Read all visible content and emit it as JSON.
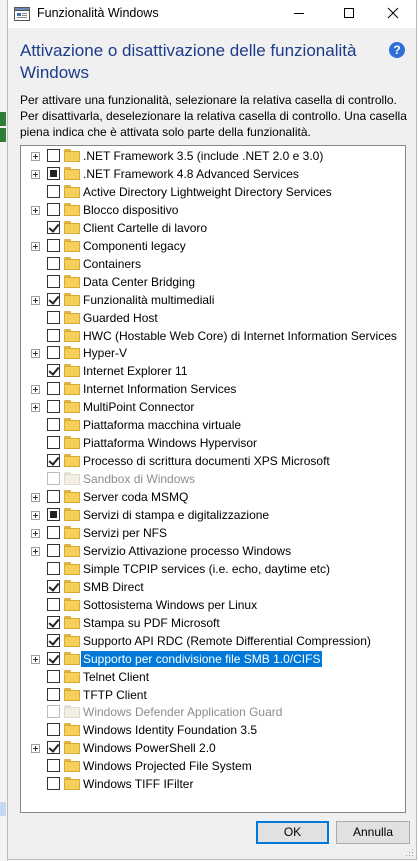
{
  "window": {
    "title": "Funzionalità Windows",
    "heading": "Attivazione o disattivazione delle funzionalità Windows",
    "description": "Per attivare una funzionalità, selezionare la relativa casella di controllo. Per disattivarla, deselezionare la relativa casella di controllo. Una casella piena indica che è attivata solo parte della funzionalità.",
    "help": "?"
  },
  "features": [
    {
      "label": ".NET Framework 3.5 (include .NET 2.0 e 3.0)",
      "expandable": true,
      "state": "unchecked",
      "enabled": true
    },
    {
      "label": ".NET Framework 4.8 Advanced Services",
      "expandable": true,
      "state": "partial",
      "enabled": true
    },
    {
      "label": "Active Directory Lightweight Directory Services",
      "expandable": false,
      "state": "unchecked",
      "enabled": true
    },
    {
      "label": "Blocco dispositivo",
      "expandable": true,
      "state": "unchecked",
      "enabled": true
    },
    {
      "label": "Client Cartelle di lavoro",
      "expandable": false,
      "state": "checked",
      "enabled": true
    },
    {
      "label": "Componenti legacy",
      "expandable": true,
      "state": "unchecked",
      "enabled": true
    },
    {
      "label": "Containers",
      "expandable": false,
      "state": "unchecked",
      "enabled": true
    },
    {
      "label": "Data Center Bridging",
      "expandable": false,
      "state": "unchecked",
      "enabled": true
    },
    {
      "label": "Funzionalità multimediali",
      "expandable": true,
      "state": "checked",
      "enabled": true
    },
    {
      "label": "Guarded Host",
      "expandable": false,
      "state": "unchecked",
      "enabled": true
    },
    {
      "label": "HWC (Hostable Web Core) di Internet Information Services",
      "expandable": false,
      "state": "unchecked",
      "enabled": true
    },
    {
      "label": "Hyper-V",
      "expandable": true,
      "state": "unchecked",
      "enabled": true
    },
    {
      "label": "Internet Explorer 11",
      "expandable": false,
      "state": "checked",
      "enabled": true
    },
    {
      "label": "Internet Information Services",
      "expandable": true,
      "state": "unchecked",
      "enabled": true
    },
    {
      "label": "MultiPoint Connector",
      "expandable": true,
      "state": "unchecked",
      "enabled": true
    },
    {
      "label": "Piattaforma macchina virtuale",
      "expandable": false,
      "state": "unchecked",
      "enabled": true
    },
    {
      "label": "Piattaforma Windows Hypervisor",
      "expandable": false,
      "state": "unchecked",
      "enabled": true
    },
    {
      "label": "Processo di scrittura documenti XPS Microsoft",
      "expandable": false,
      "state": "checked",
      "enabled": true
    },
    {
      "label": "Sandbox di Windows",
      "expandable": false,
      "state": "unchecked",
      "enabled": false
    },
    {
      "label": "Server coda MSMQ",
      "expandable": true,
      "state": "unchecked",
      "enabled": true
    },
    {
      "label": "Servizi di stampa e digitalizzazione",
      "expandable": true,
      "state": "partial",
      "enabled": true
    },
    {
      "label": "Servizi per NFS",
      "expandable": true,
      "state": "unchecked",
      "enabled": true
    },
    {
      "label": "Servizio Attivazione processo Windows",
      "expandable": true,
      "state": "unchecked",
      "enabled": true
    },
    {
      "label": "Simple TCPIP services (i.e. echo, daytime etc)",
      "expandable": false,
      "state": "unchecked",
      "enabled": true
    },
    {
      "label": "SMB Direct",
      "expandable": false,
      "state": "checked",
      "enabled": true
    },
    {
      "label": "Sottosistema Windows per Linux",
      "expandable": false,
      "state": "unchecked",
      "enabled": true
    },
    {
      "label": "Stampa su PDF Microsoft",
      "expandable": false,
      "state": "checked",
      "enabled": true
    },
    {
      "label": "Supporto API RDC (Remote Differential Compression)",
      "expandable": false,
      "state": "checked",
      "enabled": true
    },
    {
      "label": "Supporto per condivisione file SMB 1.0/CIFS",
      "expandable": true,
      "state": "checked",
      "enabled": true,
      "selected": true
    },
    {
      "label": "Telnet Client",
      "expandable": false,
      "state": "unchecked",
      "enabled": true
    },
    {
      "label": "TFTP Client",
      "expandable": false,
      "state": "unchecked",
      "enabled": true
    },
    {
      "label": "Windows Defender Application Guard",
      "expandable": false,
      "state": "unchecked",
      "enabled": false
    },
    {
      "label": "Windows Identity Foundation 3.5",
      "expandable": false,
      "state": "unchecked",
      "enabled": true
    },
    {
      "label": "Windows PowerShell 2.0",
      "expandable": true,
      "state": "checked",
      "enabled": true
    },
    {
      "label": "Windows Projected File System",
      "expandable": false,
      "state": "unchecked",
      "enabled": true
    },
    {
      "label": "Windows TIFF IFilter",
      "expandable": false,
      "state": "unchecked",
      "enabled": true
    }
  ],
  "buttons": {
    "ok": "OK",
    "cancel": "Annulla"
  },
  "colors": {
    "accent": "#0078d7",
    "heading": "#1c3b8a",
    "folder": "#f4cf5a"
  },
  "icons": {
    "app": "windows-features-icon",
    "help": "help-icon",
    "minimize": "minimize-icon",
    "maximize": "maximize-icon",
    "close": "close-icon"
  }
}
